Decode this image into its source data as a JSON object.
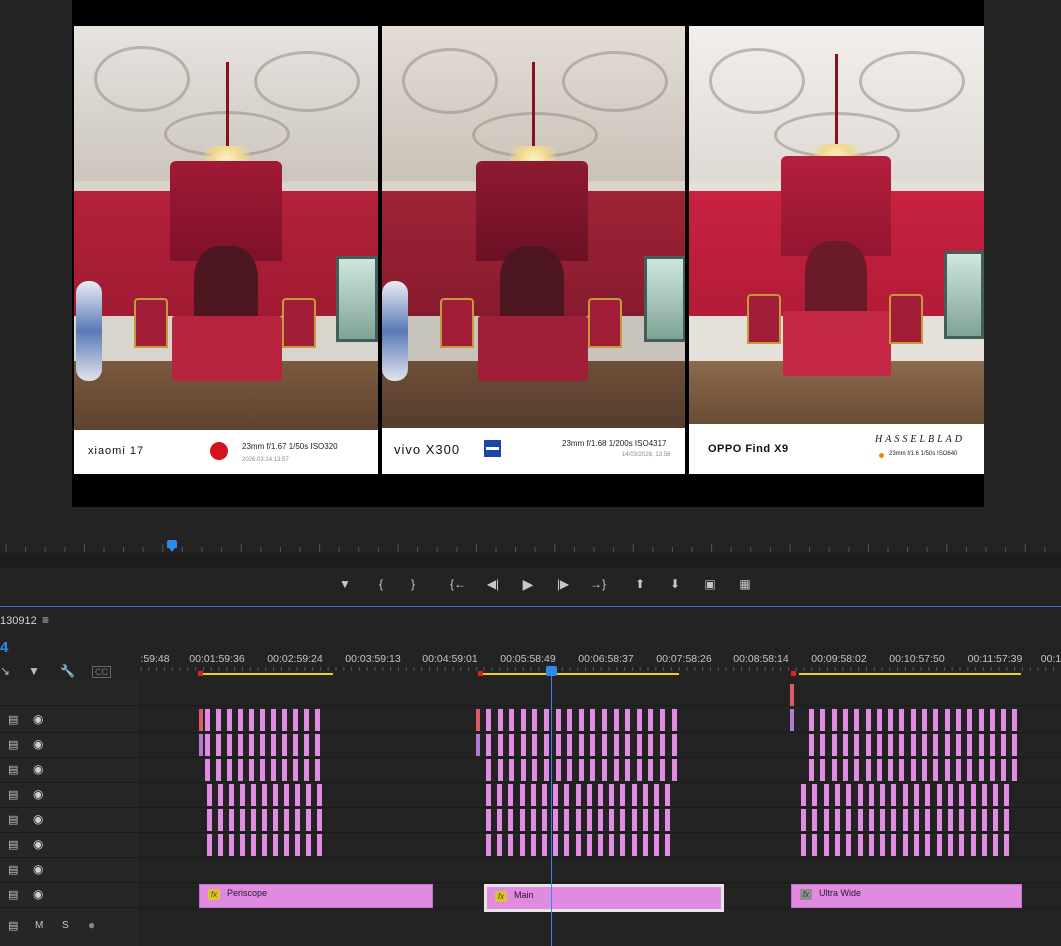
{
  "program_monitor": {
    "photos": [
      {
        "brand": "xiaomi 17",
        "specs": "23mm  f/1.67  1/50s  ISO320",
        "date": "2026.03.14  13:57",
        "logo": "leica-icon"
      },
      {
        "brand": "vivo X300",
        "specs": "23mm  f/1.68  1/200s  ISO4317",
        "date": "14/03/2026, 13:56",
        "logo": "zeiss-icon"
      },
      {
        "brand": "OPPO Find X9",
        "specs": "23mm  f/1.6  1/50s  ISO640",
        "logo_text": "HASSELBLAD",
        "logo": "hasselblad-logo"
      }
    ]
  },
  "transport": {
    "buttons": [
      "marker-icon",
      "mark-in-icon",
      "mark-out-icon",
      "go-to-in-icon",
      "step-back-icon",
      "play-icon",
      "step-forward-icon",
      "go-to-out-icon",
      "lift-icon",
      "extract-icon",
      "export-frame-icon",
      "comparison-view-icon"
    ]
  },
  "timeline": {
    "sequence_name": "130912",
    "timecode": "4",
    "ruler_labels": [
      ":59:48",
      "00:01:59:36",
      "00:02:59:24",
      "00:03:59:13",
      "00:04:59:01",
      "00:05:58:49",
      "00:06:58:37",
      "00:07:58:26",
      "00:08:58:14",
      "00:09:58:02",
      "00:10:57:50",
      "00:11:57:39",
      "00:1"
    ],
    "audio_header": {
      "mute": "M",
      "solo": "S"
    },
    "clips": [
      {
        "name": "Periscope",
        "fx": "fx"
      },
      {
        "name": "Main",
        "fx": "fx"
      },
      {
        "name": "Ultra Wide",
        "fx": "fx"
      }
    ]
  },
  "colors": {
    "accent": "#2d8ceb",
    "clip": "#e28be3",
    "work_area": "#e8d21c"
  }
}
